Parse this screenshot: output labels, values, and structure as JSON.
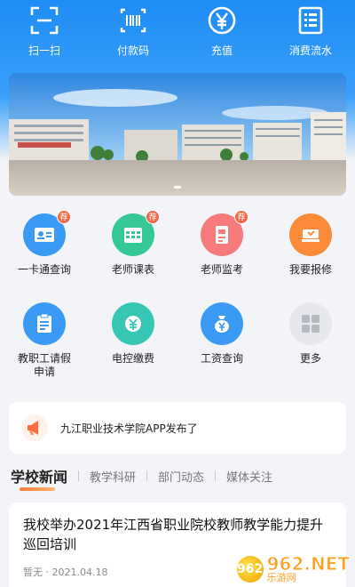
{
  "quick_actions": [
    {
      "label": "扫一扫",
      "icon": "scan-icon"
    },
    {
      "label": "付款码",
      "icon": "barcode-icon"
    },
    {
      "label": "充值",
      "icon": "yuan-icon"
    },
    {
      "label": "消费流水",
      "icon": "list-icon"
    }
  ],
  "banner": {
    "pages": 1,
    "active_page": 1
  },
  "grid": [
    {
      "label": "一卡通查询",
      "icon": "id-card-icon",
      "color": "#3b9bf4",
      "recommend": true
    },
    {
      "label": "老师课表",
      "icon": "schedule-icon",
      "color": "#36c797",
      "recommend": true
    },
    {
      "label": "老师监考",
      "icon": "exam-icon",
      "color": "#f77b7b",
      "recommend": true
    },
    {
      "label": "我要报修",
      "icon": "repair-icon",
      "color": "#fb8a39",
      "recommend": false
    },
    {
      "label": "教职工请假申请",
      "icon": "leave-icon",
      "color": "#3b9bf4",
      "recommend": false
    },
    {
      "label": "电控缴费",
      "icon": "electric-icon",
      "color": "#36c7b4",
      "recommend": false
    },
    {
      "label": "工资查询",
      "icon": "salary-icon",
      "color": "#3b9bf4",
      "recommend": false
    },
    {
      "label": "更多",
      "icon": "more-icon",
      "color": "#c8ccd2",
      "recommend": false
    }
  ],
  "badge_text": "荐",
  "notice": {
    "text": "九江职业技术学院APP发布了",
    "icon": "megaphone-icon"
  },
  "news_tabs": [
    {
      "label": "学校新闻",
      "active": true
    },
    {
      "label": "教学科研",
      "active": false
    },
    {
      "label": "部门动态",
      "active": false
    },
    {
      "label": "媒体关注",
      "active": false
    }
  ],
  "news": [
    {
      "title": "我校举办2021年江西省职业院校教师教学能力提升巡回培训",
      "author": "暂无",
      "date": "2021.04.18"
    }
  ],
  "watermark": {
    "logo_text": "962",
    "site": "962.NET",
    "name": "乐游网"
  }
}
